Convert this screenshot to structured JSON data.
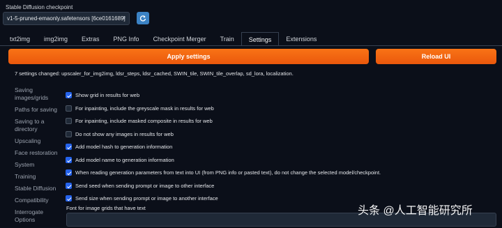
{
  "checkpoint": {
    "label": "Stable Diffusion checkpoint",
    "value": "v1-5-pruned-emaonly.safetensors [6ce0161689]",
    "caret": "▾"
  },
  "tabs": [
    "txt2img",
    "img2img",
    "Extras",
    "PNG Info",
    "Checkpoint Merger",
    "Train",
    "Settings",
    "Extensions"
  ],
  "active_tab": "Settings",
  "buttons": {
    "apply": "Apply settings",
    "reload": "Reload UI"
  },
  "changed_text": "7 settings changed: upscaler_for_img2img, ldsr_steps, ldsr_cached, SWIN_tile, SWIN_tile_overlap, sd_lora, localization.",
  "sidebar": [
    "Saving images/grids",
    "Paths for saving",
    "Saving to a directory",
    "Upscaling",
    "Face restoration",
    "System",
    "Training",
    "Stable Diffusion",
    "Compatibility",
    "Interrogate Options"
  ],
  "options": [
    {
      "label": "Show grid in results for web",
      "checked": true
    },
    {
      "label": "For inpainting, include the greyscale mask in results for web",
      "checked": false
    },
    {
      "label": "For inpainting, include masked composite in results for web",
      "checked": false
    },
    {
      "label": "Do not show any images in results for web",
      "checked": false
    },
    {
      "label": "Add model hash to generation information",
      "checked": true
    },
    {
      "label": "Add model name to generation information",
      "checked": true
    },
    {
      "label": "When reading generation parameters from text into UI (from PNG info or pasted text), do not change the selected model/checkpoint.",
      "checked": true
    },
    {
      "label": "Send seed when sending prompt or image to other interface",
      "checked": true
    },
    {
      "label": "Send size when sending prompt or image to another interface",
      "checked": true
    }
  ],
  "font_label": "Font for image grids that have text",
  "font_value": "",
  "watermark": "头条 @人工智能研究所",
  "colors": {
    "accent": "#f97316",
    "checkbox": "#2563eb",
    "background": "#0b0f19"
  }
}
